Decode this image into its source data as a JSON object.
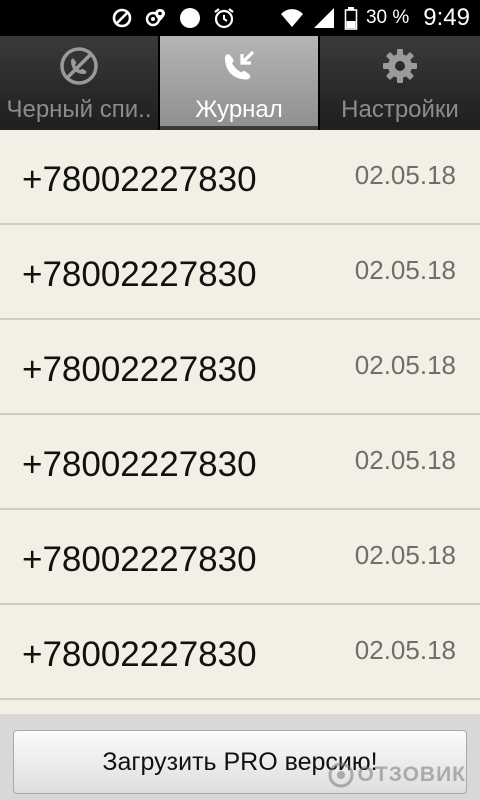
{
  "status_bar": {
    "icons_left": [
      "block-icon",
      "location-settings-icon",
      "circle-dot-icon",
      "alarm-icon"
    ],
    "icons_right": [
      "wifi-icon",
      "signal-icon",
      "battery-icon"
    ],
    "battery_percent": "30 %",
    "time": "9:49"
  },
  "tabs": [
    {
      "label": "Черный спи..",
      "icon": "blocked-call-icon",
      "active": false
    },
    {
      "label": "Журнал",
      "icon": "call-log-icon",
      "active": true
    },
    {
      "label": "Настройки",
      "icon": "gear-icon",
      "active": false
    }
  ],
  "log": {
    "rows": [
      {
        "number": "+78002227830",
        "date": "02.05.18"
      },
      {
        "number": "+78002227830",
        "date": "02.05.18"
      },
      {
        "number": "+78002227830",
        "date": "02.05.18"
      },
      {
        "number": "+78002227830",
        "date": "02.05.18"
      },
      {
        "number": "+78002227830",
        "date": "02.05.18"
      },
      {
        "number": "+78002227830",
        "date": "02.05.18"
      }
    ]
  },
  "pro_button": {
    "label": "Загрузить PRO версию!"
  },
  "watermark": {
    "text": "ОТЗОВИК"
  },
  "colors": {
    "list_bg": "#f2f0e4",
    "tab_active": "#9e9e9e",
    "tab_inactive": "#2a2a2a"
  }
}
